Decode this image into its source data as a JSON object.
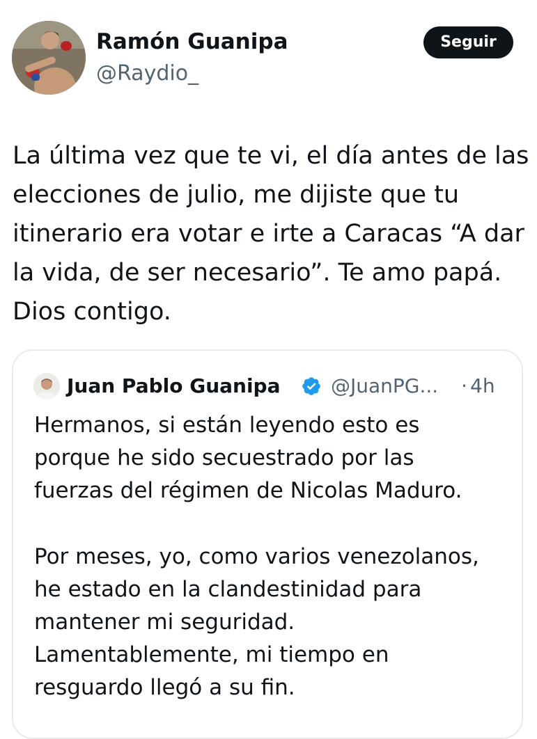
{
  "author": {
    "name": "Ramón Guanipa",
    "handle": "@Raydio_",
    "follow_label": "Seguir"
  },
  "tweet": {
    "lines": [
      "La última vez que te vi, el día antes de las",
      "elecciones de julio, me dijiste que tu",
      "itinerario era votar e irte a Caracas “A dar",
      "la vida, de ser necesario”. Te amo papá.",
      "Dios contigo."
    ]
  },
  "quoted": {
    "name": "Juan Pablo Guanipa",
    "handle": "@JuanPG...",
    "separator": "·",
    "time": "4h",
    "paragraph1": [
      "Hermanos, si están leyendo esto es",
      "porque he sido secuestrado por las",
      "fuerzas del régimen de Nicolas Maduro."
    ],
    "paragraph2": [
      "Por meses, yo, como varios venezolanos,",
      "he estado en la clandestinidad para",
      "mantener mi seguridad.",
      "Lamentablemente, mi tiempo en",
      "resguardo llegó a su fin."
    ]
  },
  "icons": {
    "verified": "verified-badge-icon"
  },
  "colors": {
    "text_primary": "#0f1419",
    "text_secondary": "#536471",
    "follow_bg": "#0f1419",
    "verified_blue": "#1d9bf0",
    "card_border": "#e8ebed"
  }
}
